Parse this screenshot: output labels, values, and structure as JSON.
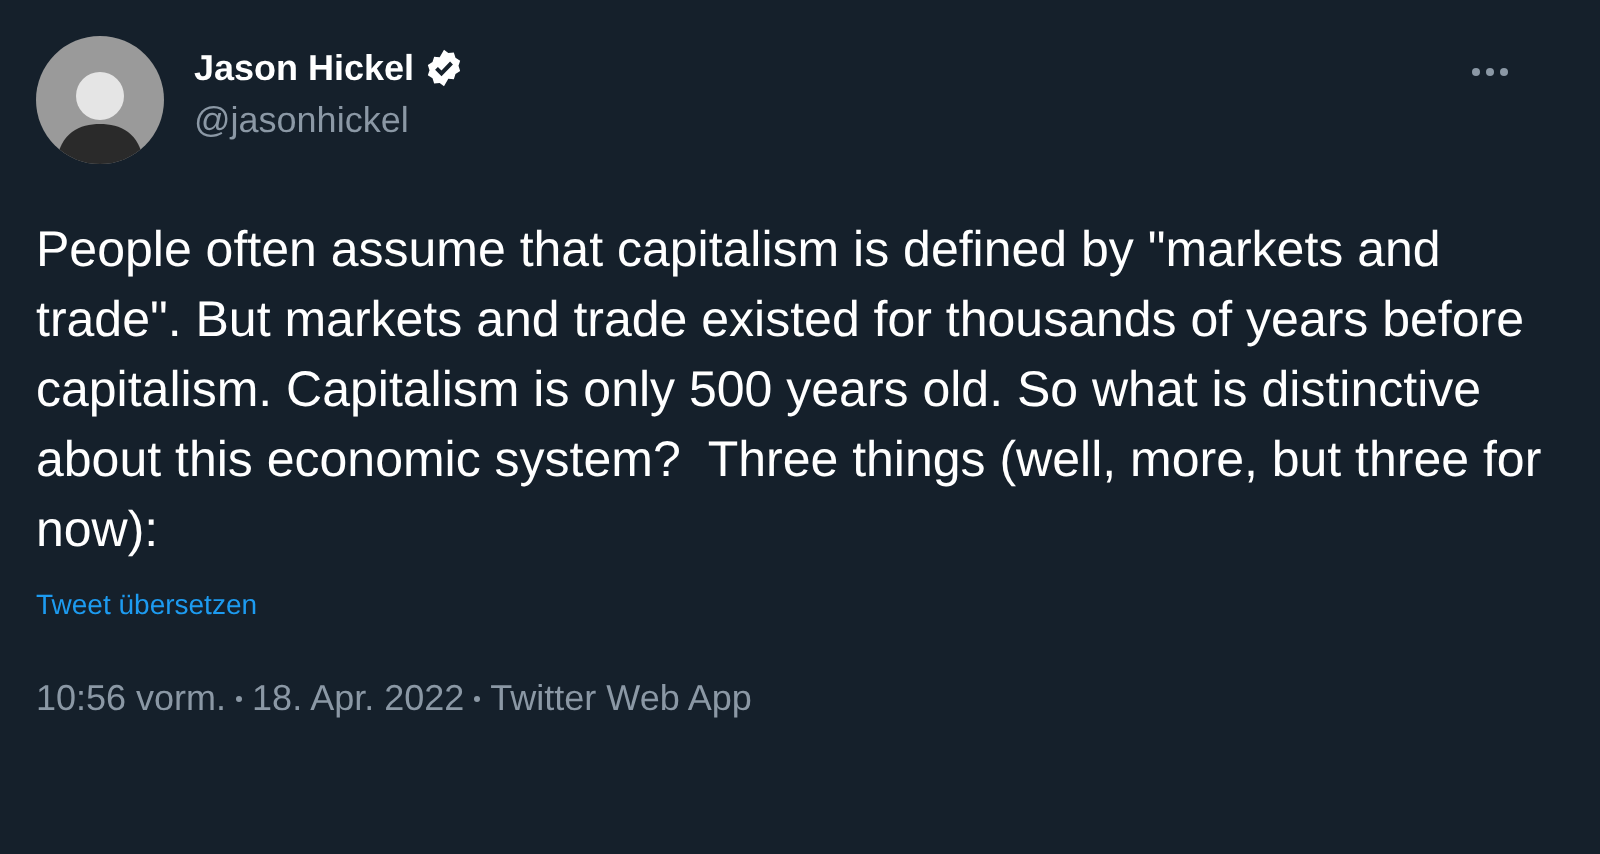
{
  "author": {
    "name": "Jason Hickel",
    "verified": true,
    "handle": "@jasonhickel"
  },
  "text": "People often assume that capitalism is defined by \"markets and trade\". But markets and trade existed for thousands of years before capitalism. Capitalism is only 500 years old. So what is distinctive about this economic system?  Three things (well, more, but three for now):",
  "translate_link": "Tweet übersetzen",
  "meta": [
    "10:56 vorm.",
    "18. Apr. 2022",
    "Twitter Web App"
  ]
}
